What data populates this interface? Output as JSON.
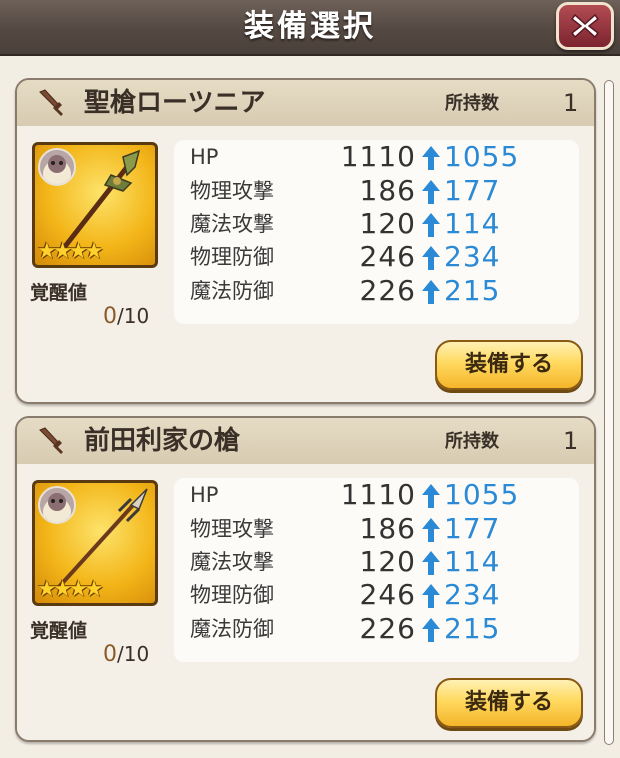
{
  "header": {
    "title": "装備選択"
  },
  "owned_label": "所持数",
  "awaken_label": "覚醒値",
  "equip_label": "装備する",
  "colors": {
    "stat_new": "#2b8ad6",
    "header_bg": "#544942",
    "equip_button": "#ffd95f"
  },
  "items": [
    {
      "name": "聖槍ローツニア",
      "owned": "1",
      "rarity": "★★★★",
      "awaken": {
        "current": "0",
        "max": "/10"
      },
      "stats": [
        {
          "label": "HP",
          "current": "1110",
          "new": "1055"
        },
        {
          "label": "物理攻撃",
          "current": "186",
          "new": "177"
        },
        {
          "label": "魔法攻撃",
          "current": "120",
          "new": "114"
        },
        {
          "label": "物理防御",
          "current": "246",
          "new": "234"
        },
        {
          "label": "魔法防御",
          "current": "226",
          "new": "215"
        }
      ]
    },
    {
      "name": "前田利家の槍",
      "owned": "1",
      "rarity": "★★★★",
      "awaken": {
        "current": "0",
        "max": "/10"
      },
      "stats": [
        {
          "label": "HP",
          "current": "1110",
          "new": "1055"
        },
        {
          "label": "物理攻撃",
          "current": "186",
          "new": "177"
        },
        {
          "label": "魔法攻撃",
          "current": "120",
          "new": "114"
        },
        {
          "label": "物理防御",
          "current": "246",
          "new": "234"
        },
        {
          "label": "魔法防御",
          "current": "226",
          "new": "215"
        }
      ]
    }
  ]
}
